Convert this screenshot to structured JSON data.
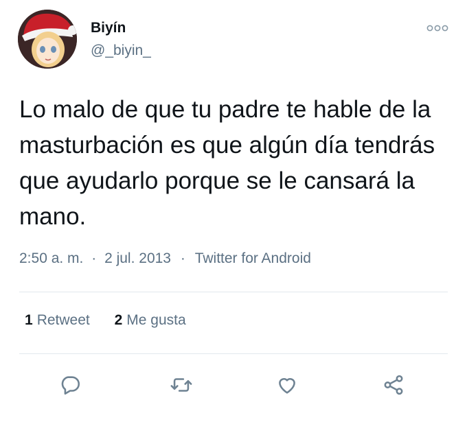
{
  "user": {
    "display_name": "Biyín",
    "handle": "@_biyin_"
  },
  "tweet": {
    "text": "Lo malo de que tu padre te hable de la masturbación es que algún día tendrás que ayudarlo porque se le cansará la mano.",
    "time": "2:50 a. m.",
    "date": "2 jul. 2013",
    "source": "Twitter for Android",
    "separator": "·"
  },
  "stats": {
    "retweets_count": "1",
    "retweets_label": "Retweet",
    "likes_count": "2",
    "likes_label": "Me gusta"
  },
  "icons": {
    "more": "more-icon",
    "reply": "reply-icon",
    "retweet": "retweet-icon",
    "like": "like-icon",
    "share": "share-icon"
  },
  "colors": {
    "text": "#0f1419",
    "secondary": "#5b7083",
    "divider": "#e1e8ed",
    "icon": "#6e8292"
  }
}
